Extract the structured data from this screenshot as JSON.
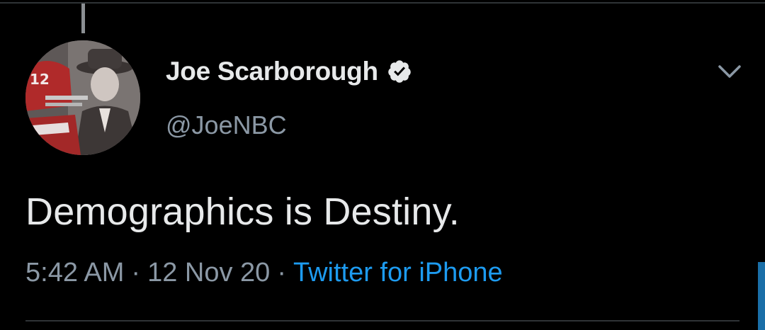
{
  "tweet": {
    "author": {
      "display_name": "Joe Scarborough",
      "handle": "@JoeNBC",
      "verified": true,
      "avatar_icon": "profile-photo-avatar"
    },
    "text": "Demographics is Destiny.",
    "time": "5:42 AM",
    "separator": "·",
    "date": "12 Nov 20",
    "source": "Twitter for iPhone"
  },
  "colors": {
    "background": "#000000",
    "primary_text": "#e7e9ea",
    "secondary_text": "#8b98a5",
    "link": "#1d9bf0",
    "divider": "#2f3336"
  },
  "icons": {
    "verified": "verified-badge-icon",
    "more": "chevron-down-icon"
  }
}
